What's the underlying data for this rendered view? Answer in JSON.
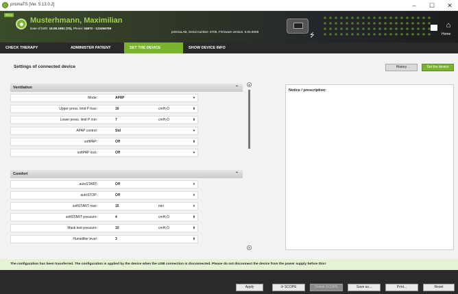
{
  "window": {
    "title": "prismaTS [Ver. 5.13.0.2]",
    "minimize": "–",
    "maximize": "☐",
    "close": "✕"
  },
  "header": {
    "menu_label": "Menu",
    "patient_name": "Musterhmann, Maximilian",
    "dob_label": "Date of birth:",
    "dob_value": "19.08.1951 (70),",
    "phone_label": "Phone:",
    "phone_value": "04872 - 123456789",
    "device_info": "prismaLAB, Serial number: 6705, Firmware version: 5.05.9008",
    "home_label": "Home"
  },
  "tabs": [
    {
      "label": "CHECK THERAPY",
      "active": false
    },
    {
      "label": "ADMINISTER PATIENT",
      "active": false
    },
    {
      "label": "SET THE DEVICE",
      "active": true
    },
    {
      "label": "SHOW DEVICE INFO",
      "active": false
    }
  ],
  "settings": {
    "title": "Settings of connected device",
    "history_button": "History",
    "set_device_button": "Set the device",
    "groups": [
      {
        "name": "Ventilation",
        "rows": [
          {
            "label": "Mode:",
            "value": "APAP",
            "unit": "",
            "control": "dropdown"
          },
          {
            "label": "Upper press. limit P max:",
            "value": "16",
            "unit": "cmH₂O",
            "control": "stepper"
          },
          {
            "label": "Lower press. limit P min:",
            "value": "7",
            "unit": "cmH₂O",
            "control": "stepper"
          },
          {
            "label": "APAP control:",
            "value": "Std",
            "unit": "",
            "control": "dropdown"
          },
          {
            "label": "softPAP:",
            "value": "Off",
            "unit": "",
            "control": "stepper"
          },
          {
            "label": "softPAP lock:",
            "value": "Off",
            "unit": "",
            "control": "dropdown"
          }
        ]
      },
      {
        "name": "Comfort",
        "rows": [
          {
            "label": "autoSTART:",
            "value": "Off",
            "unit": "",
            "control": "dropdown"
          },
          {
            "label": "autoSTOP:",
            "value": "Off",
            "unit": "",
            "control": "dropdown"
          },
          {
            "label": "softSTART max:",
            "value": "15",
            "unit": "min",
            "control": "dropdown"
          },
          {
            "label": "softSTART pressure:",
            "value": "4",
            "unit": "cmH₂O",
            "control": "stepper"
          },
          {
            "label": "Mask test pressure:",
            "value": "10",
            "unit": "cmH₂O",
            "control": "stepper"
          },
          {
            "label": "Humidifier level:",
            "value": "3",
            "unit": "",
            "control": "stepper"
          }
        ]
      }
    ]
  },
  "notice": {
    "label": "Notice / prescription:"
  },
  "message": "The configuration has been transferred. The configuration is applied by the device when the USB connection is disconnected. Please do not disconnect the device from the power supply before this!",
  "bottom_buttons": {
    "apply": "Apply",
    "scope": "SCOPE",
    "delete_scope": "Delete SCOPE",
    "save_as": "Save as...",
    "print": "Print...",
    "reset": "Reset"
  },
  "icons": {
    "dropdown": "▾",
    "stepper": "⬍",
    "collapse": "⌃"
  },
  "colors": {
    "accent": "#7ab32e",
    "dark": "#2a2a2a"
  }
}
